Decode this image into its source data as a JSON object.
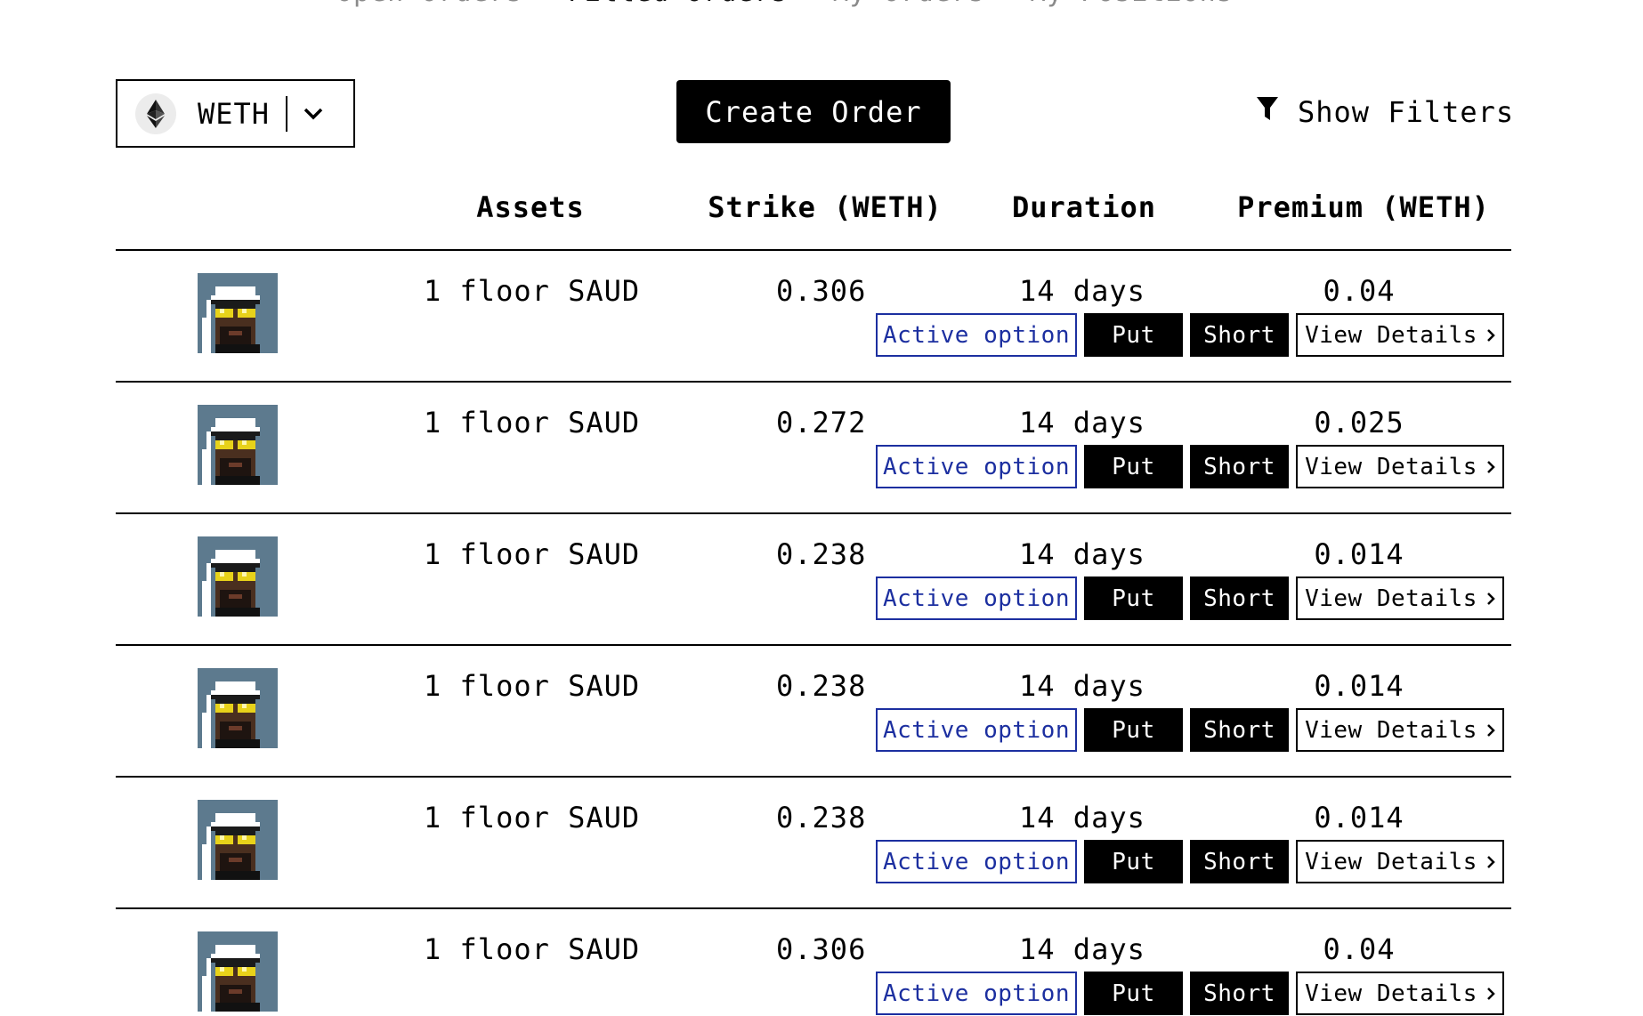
{
  "tabs": [
    {
      "label": "Open Orders",
      "active": false
    },
    {
      "label": "Filled Orders",
      "active": true
    },
    {
      "label": "My Orders",
      "active": false
    },
    {
      "label": "My Positions",
      "active": false
    }
  ],
  "toolbar": {
    "asset_selected": "WETH",
    "asset_icon": "ethereum-icon",
    "create_label": "Create Order",
    "filters_label": "Show Filters",
    "filters_icon": "funnel-icon"
  },
  "table": {
    "headers": {
      "assets": "Assets",
      "strike": "Strike (WETH)",
      "duration": "Duration",
      "premium": "Premium (WETH)"
    },
    "rows": [
      {
        "assets": "1 floor SAUD",
        "strike": "0.306",
        "duration": "14 days",
        "premium": "0.04",
        "status": "Active option",
        "type": "Put",
        "side": "Short",
        "action": "View Details"
      },
      {
        "assets": "1 floor SAUD",
        "strike": "0.272",
        "duration": "14 days",
        "premium": "0.025",
        "status": "Active option",
        "type": "Put",
        "side": "Short",
        "action": "View Details"
      },
      {
        "assets": "1 floor SAUD",
        "strike": "0.238",
        "duration": "14 days",
        "premium": "0.014",
        "status": "Active option",
        "type": "Put",
        "side": "Short",
        "action": "View Details"
      },
      {
        "assets": "1 floor SAUD",
        "strike": "0.238",
        "duration": "14 days",
        "premium": "0.014",
        "status": "Active option",
        "type": "Put",
        "side": "Short",
        "action": "View Details"
      },
      {
        "assets": "1 floor SAUD",
        "strike": "0.238",
        "duration": "14 days",
        "premium": "0.014",
        "status": "Active option",
        "type": "Put",
        "side": "Short",
        "action": "View Details"
      },
      {
        "assets": "1 floor SAUD",
        "strike": "0.306",
        "duration": "14 days",
        "premium": "0.04",
        "status": "Active option",
        "type": "Put",
        "side": "Short",
        "action": "View Details"
      }
    ]
  },
  "colors": {
    "accent_blue": "#1c2fa0",
    "nft_background": "#5d7a8e"
  }
}
